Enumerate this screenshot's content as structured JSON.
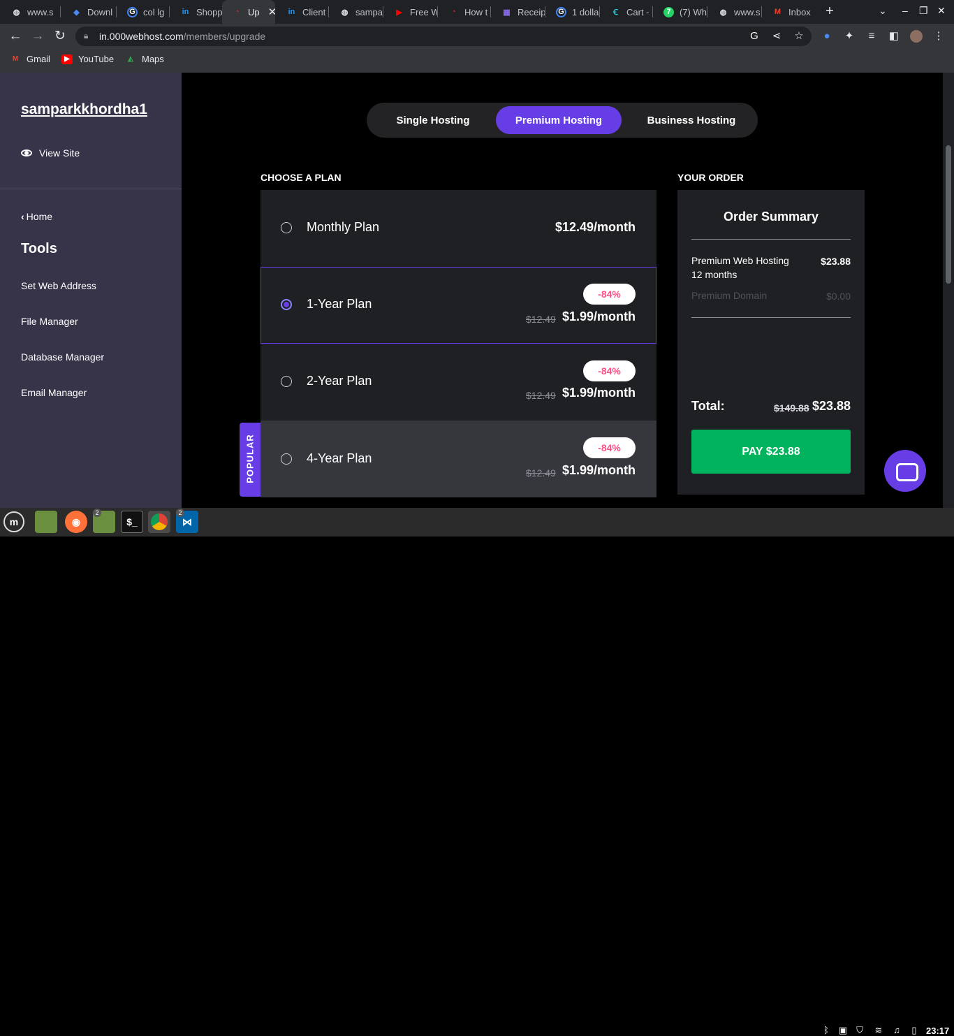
{
  "browser": {
    "tabs": [
      {
        "label": "www.s",
        "icon": "globe-icon"
      },
      {
        "label": "Downl",
        "icon": "diamond-icon"
      },
      {
        "label": "col lg",
        "icon": "google-icon"
      },
      {
        "label": "Shopp",
        "icon": "in-icon"
      },
      {
        "label": "Up",
        "icon": "webhost-icon",
        "active": true
      },
      {
        "label": "Client",
        "icon": "in-icon"
      },
      {
        "label": "sampa",
        "icon": "globe-icon"
      },
      {
        "label": "Free W",
        "icon": "youtube-icon"
      },
      {
        "label": "How t",
        "icon": "webhost-icon"
      },
      {
        "label": "Receip",
        "icon": "receipt-icon"
      },
      {
        "label": "1 dolla",
        "icon": "google-icon"
      },
      {
        "label": "Cart -",
        "icon": "cart-icon"
      },
      {
        "label": "(7) Wh",
        "icon": "whatsapp-icon"
      },
      {
        "label": "www.s",
        "icon": "globe-icon"
      },
      {
        "label": "Inbox",
        "icon": "gmail-icon"
      }
    ],
    "url_host": "in.000webhost.com",
    "url_path": "/members/upgrade",
    "bookmarks": [
      {
        "label": "Gmail",
        "icon": "gmail-icon"
      },
      {
        "label": "YouTube",
        "icon": "youtube-icon"
      },
      {
        "label": "Maps",
        "icon": "maps-icon"
      }
    ]
  },
  "sidebar": {
    "site_name": "samparkkhordha1",
    "view_site": "View Site",
    "home": "Home",
    "tools_heading": "Tools",
    "items": [
      "Set Web Address",
      "File Manager",
      "Database Manager",
      "Email Manager"
    ]
  },
  "hosting_tabs": {
    "items": [
      "Single Hosting",
      "Premium Hosting",
      "Business Hosting"
    ],
    "active": "Premium Hosting"
  },
  "plans": {
    "heading": "CHOOSE A PLAN",
    "items": [
      {
        "name": "Monthly Plan",
        "price": "$12.49/month"
      },
      {
        "name": "1-Year Plan",
        "price": "$1.99/month",
        "old_price": "$12.49",
        "badge": "-84%",
        "selected": true
      },
      {
        "name": "2-Year Plan",
        "price": "$1.99/month",
        "old_price": "$12.49",
        "badge": "-84%"
      },
      {
        "name": "4-Year Plan",
        "price": "$1.99/month",
        "old_price": "$12.49",
        "badge": "-84%",
        "popular": true
      }
    ],
    "popular_label": "POPULAR"
  },
  "order": {
    "heading": "YOUR ORDER",
    "title": "Order Summary",
    "line1_label": "Premium Web Hosting",
    "line1_sub": "12 months",
    "line1_value": "$23.88",
    "line2_label": "Premium Domain",
    "line2_value": "$0.00",
    "total_label": "Total:",
    "total_old": "$149.88",
    "total_new": "$23.88",
    "pay_label": "PAY $23.88"
  },
  "taskbar": {
    "clock": "23:17",
    "badges": [
      "2",
      "2"
    ]
  },
  "colors": {
    "accent": "#673de6",
    "pay": "#00b35c",
    "badge_text": "#fc5185"
  }
}
